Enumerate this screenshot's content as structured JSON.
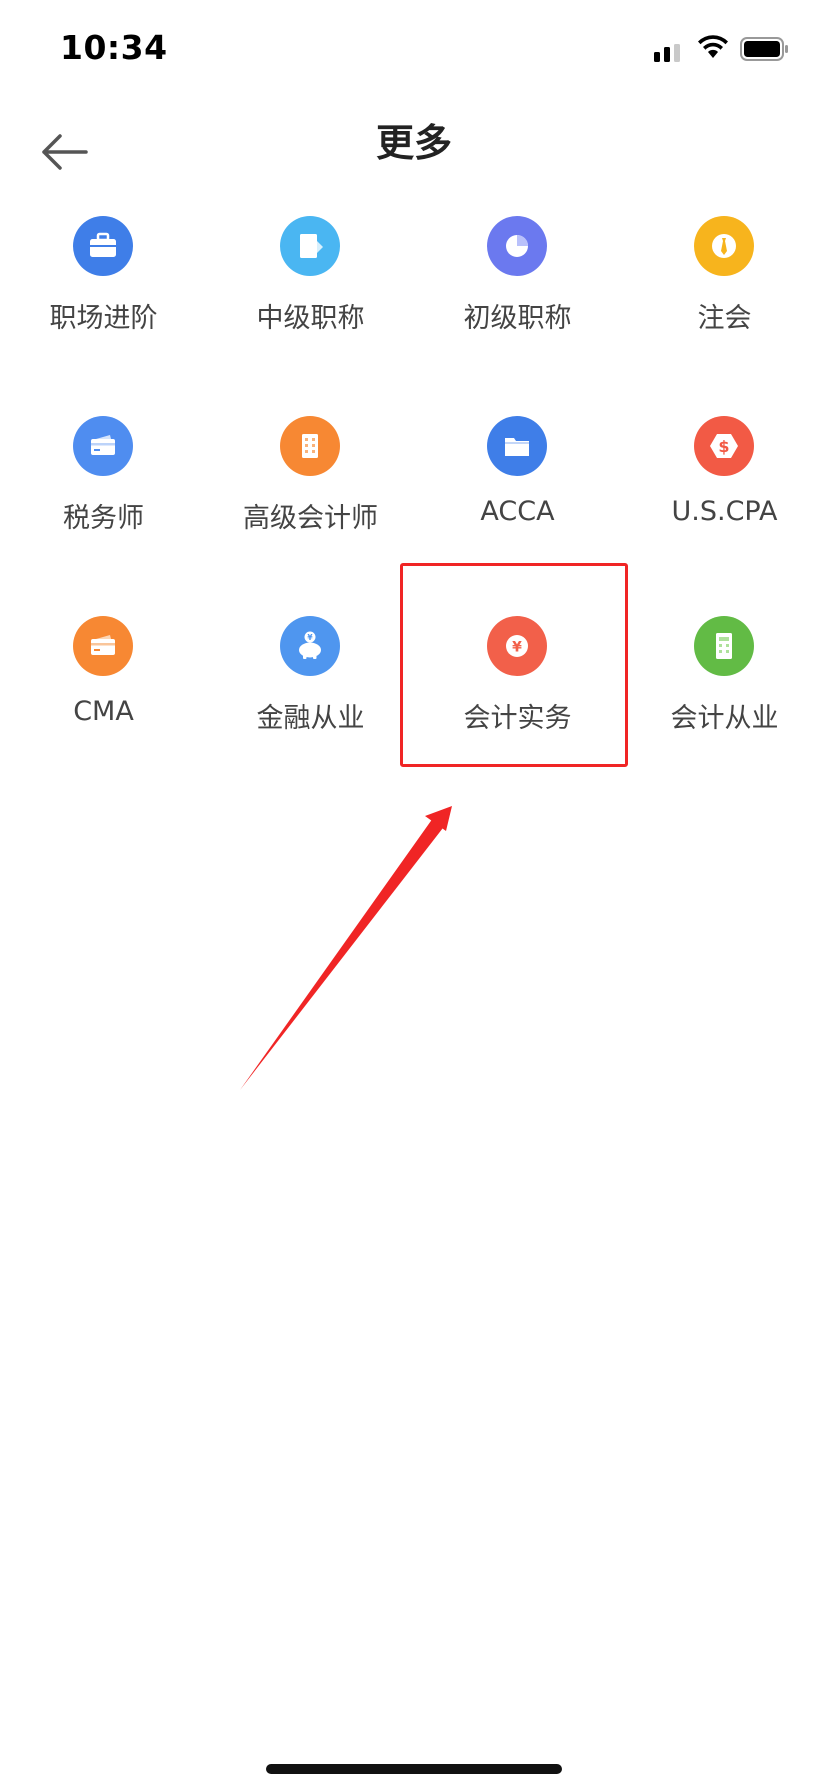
{
  "status_bar": {
    "time": "10:34"
  },
  "nav": {
    "title": "更多"
  },
  "categories": [
    {
      "label": "职场进阶",
      "icon": "briefcase-icon",
      "color": "#3f7ee8"
    },
    {
      "label": "中级职称",
      "icon": "document-icon",
      "color": "#4ab6f2"
    },
    {
      "label": "初级职称",
      "icon": "pie-chart-icon",
      "color": "#6b79ef"
    },
    {
      "label": "注会",
      "icon": "tie-icon",
      "color": "#f7b41d"
    },
    {
      "label": "税务师",
      "icon": "card-icon",
      "color": "#4f8df0"
    },
    {
      "label": "高级会计师",
      "icon": "building-icon",
      "color": "#f78833"
    },
    {
      "label": "ACCA",
      "icon": "folder-icon",
      "color": "#3f7ee8"
    },
    {
      "label": "U.S.CPA",
      "icon": "dollar-hexagon-icon",
      "color": "#f25a45"
    },
    {
      "label": "CMA",
      "icon": "card-icon",
      "color": "#f78833"
    },
    {
      "label": "金融从业",
      "icon": "piggy-bank-icon",
      "color": "#4f96ef"
    },
    {
      "label": "会计实务",
      "icon": "yuan-coin-icon",
      "color": "#f2604a"
    },
    {
      "label": "会计从业",
      "icon": "calculator-icon",
      "color": "#62bb45"
    }
  ],
  "annotation": {
    "highlight_color": "#f02525",
    "highlighted_item": "会计实务"
  }
}
